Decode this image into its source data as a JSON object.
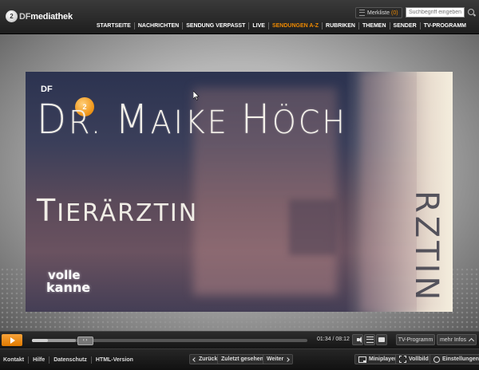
{
  "header": {
    "logo_mark": "2",
    "logo_text_a": "DF",
    "logo_text_b": "mediathek",
    "merkliste_label": "Merkliste",
    "merkliste_count": "(0)",
    "search_placeholder": "Suchbegriff eingeben",
    "nav": [
      {
        "label": "STARTSEITE",
        "active": false
      },
      {
        "label": "NACHRICHTEN",
        "active": false
      },
      {
        "label": "SENDUNG VERPASST",
        "active": false
      },
      {
        "label": "LIVE",
        "active": false
      },
      {
        "label": "SENDUNGEN A-Z",
        "active": true
      },
      {
        "label": "RUBRIKEN",
        "active": false
      },
      {
        "label": "THEMEN",
        "active": false
      },
      {
        "label": "SENDER",
        "active": false
      },
      {
        "label": "TV-PROGRAMM",
        "active": false
      }
    ]
  },
  "video": {
    "channel_logo_a": "2",
    "channel_logo_b": "DF",
    "title_line1_cap": "D",
    "title_line1_rest": "R. ",
    "title_line1_cap2": "M",
    "title_line1_rest2": "AIKE ",
    "title_line1_cap3": "H",
    "title_line1_rest3": "ÖCH",
    "title_line2_cap": "T",
    "title_line2_rest": "IERÄRZTIN",
    "vertical_text": "RZTIN",
    "show_logo_line1": "volle",
    "show_logo_line2": "kanne"
  },
  "controls": {
    "progress": 0.19,
    "buffered": 0.16,
    "time": "01:34 / 08:12",
    "tv_programm": "TV-Programm",
    "mehr_infos": "mehr Infos"
  },
  "footer": {
    "links": [
      "Kontakt",
      "Hilfe",
      "Datenschutz",
      "HTML-Version"
    ],
    "zurueck": "Zurück",
    "zuletzt": "Zuletzt gesehen",
    "weiter": "Weiter",
    "miniplayer": "Miniplayer",
    "vollbild": "Vollbild",
    "einstellungen": "Einstellungen"
  },
  "colors": {
    "accent": "#f08a00"
  }
}
